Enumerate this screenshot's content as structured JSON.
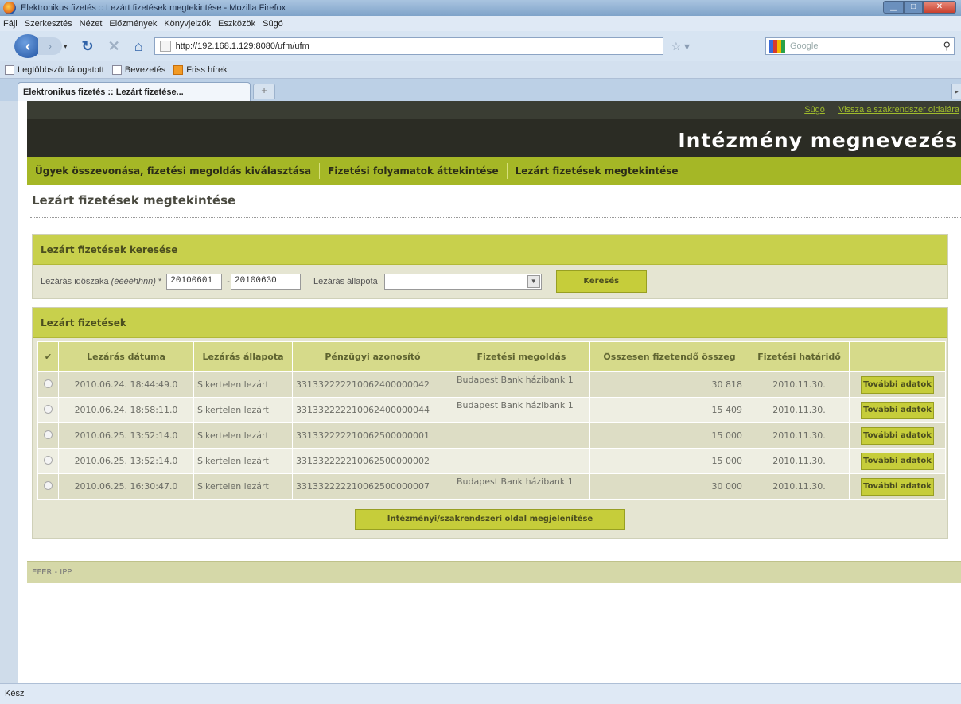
{
  "window": {
    "title": "Elektronikus fizetés :: Lezárt fizetések megtekintése - Mozilla Firefox"
  },
  "menubar": [
    "Fájl",
    "Szerkesztés",
    "Nézet",
    "Előzmények",
    "Könyvjelzők",
    "Eszközök",
    "Súgó"
  ],
  "navbar": {
    "url": "http://192.168.1.129:8080/ufm/ufm",
    "search_placeholder": "Google"
  },
  "bookmarks": [
    "Legtöbbször látogatott",
    "Bevezetés",
    "Friss hírek"
  ],
  "tab": {
    "label": "Elektronikus fizetés :: Lezárt fizetése...",
    "new_tab": "+"
  },
  "site": {
    "top_links": [
      "Súgó",
      "Vissza a szakrendszer oldalára"
    ],
    "institution_name": "Intézmény megnevezés",
    "nav": [
      "Ügyek összevonása, fizetési megoldás kiválasztása",
      "Fizetési folyamatok áttekintése",
      "Lezárt fizetések megtekintése"
    ],
    "page_title": "Lezárt fizetések megtekintése"
  },
  "search_panel": {
    "title": "Lezárt fizetések keresése",
    "period_label": "Lezárás időszaka ",
    "period_format": "(ééééhhnn)",
    "period_required": " *",
    "date_from": "20100601",
    "date_sep": "-",
    "date_to": "20100630",
    "status_label": "Lezárás állapota",
    "status_value": "",
    "search_button": "Keresés"
  },
  "results": {
    "title": "Lezárt fizetések",
    "columns": [
      "✔",
      "Lezárás dátuma",
      "Lezárás állapota",
      "Pénzügyi azonosító",
      "Fizetési megoldás",
      "Összesen fizetendő összeg",
      "Fizetési határidő",
      ""
    ],
    "rows": [
      {
        "date": "2010.06.24. 18:44:49.0",
        "status": "Sikertelen lezárt",
        "id": "331332222210062400000042",
        "solution": "Budapest Bank házibank 1",
        "amount": "30 818",
        "deadline": "2010.11.30.",
        "button": "További adatok"
      },
      {
        "date": "2010.06.24. 18:58:11.0",
        "status": "Sikertelen lezárt",
        "id": "331332222210062400000044",
        "solution": "Budapest Bank házibank 1",
        "amount": "15 409",
        "deadline": "2010.11.30.",
        "button": "További adatok"
      },
      {
        "date": "2010.06.25. 13:52:14.0",
        "status": "Sikertelen lezárt",
        "id": "331332222210062500000001",
        "solution": "",
        "amount": "15 000",
        "deadline": "2010.11.30.",
        "button": "További adatok"
      },
      {
        "date": "2010.06.25. 13:52:14.0",
        "status": "Sikertelen lezárt",
        "id": "331332222210062500000002",
        "solution": "",
        "amount": "15 000",
        "deadline": "2010.11.30.",
        "button": "További adatok"
      },
      {
        "date": "2010.06.25. 16:30:47.0",
        "status": "Sikertelen lezárt",
        "id": "331332222210062500000007",
        "solution": "Budapest Bank házibank 1",
        "amount": "30 000",
        "deadline": "2010.11.30.",
        "button": "További adatok"
      }
    ],
    "bottom_button": "Intézményi/szakrendszeri oldal megjelenítése"
  },
  "footer": "EFER - IPP",
  "status_bar": "Kész",
  "colors": {
    "header_dark": "#2b2c24",
    "nav_green": "#a5b726",
    "panel_head": "#c8d04c",
    "button": "#c6cd3a"
  }
}
